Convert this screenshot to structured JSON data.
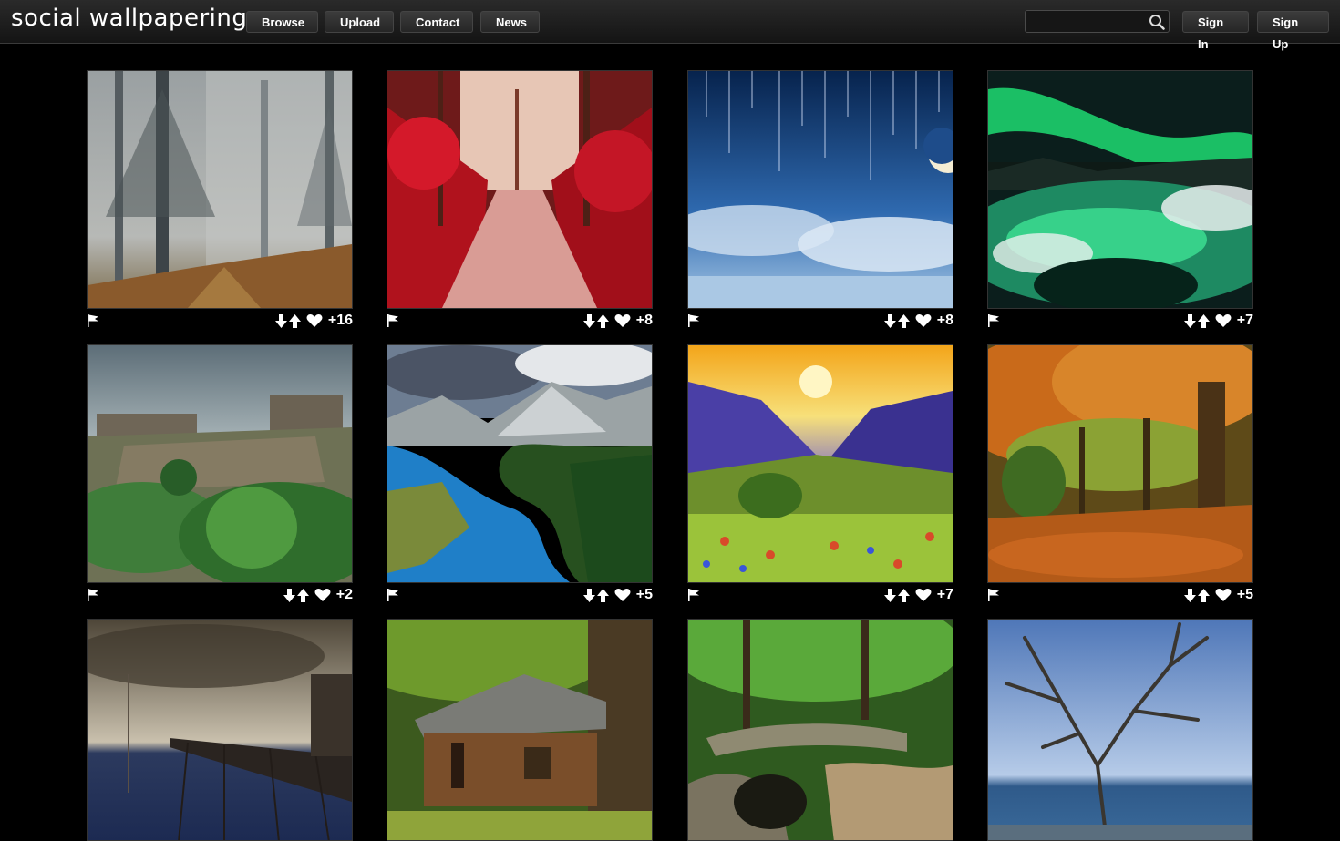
{
  "header": {
    "logo": "social wallpapering",
    "nav": [
      "Browse",
      "Upload",
      "Contact",
      "News"
    ],
    "search_placeholder": "",
    "sign_in": "Sign In",
    "sign_up": "Sign Up"
  },
  "wallpapers": [
    {
      "score": "+16"
    },
    {
      "score": "+8"
    },
    {
      "score": "+8"
    },
    {
      "score": "+7"
    },
    {
      "score": "+2"
    },
    {
      "score": "+5"
    },
    {
      "score": "+7"
    },
    {
      "score": "+5"
    },
    {},
    {},
    {},
    {}
  ]
}
